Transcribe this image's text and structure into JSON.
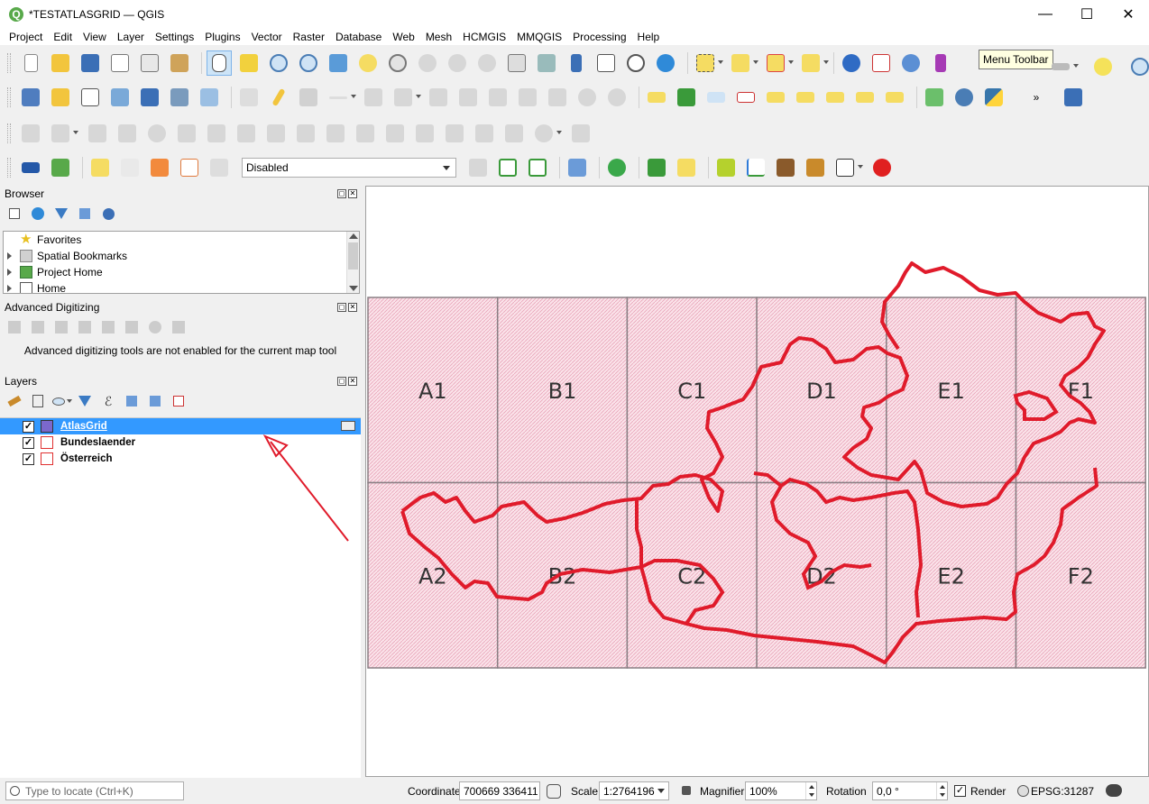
{
  "window": {
    "title": "*TESTATLASGRID — QGIS",
    "minimize": "—",
    "maximize": "☐",
    "close": "✕"
  },
  "menu": [
    "Project",
    "Edit",
    "View",
    "Layer",
    "Settings",
    "Plugins",
    "Vector",
    "Raster",
    "Database",
    "Web",
    "Mesh",
    "HCMGIS",
    "MMQGIS",
    "Processing",
    "Help"
  ],
  "tooltip": "Menu Toolbar",
  "toolbar4": {
    "select_value": "Disabled"
  },
  "browser": {
    "title": "Browser",
    "items": [
      "Favorites",
      "Spatial Bookmarks",
      "Project Home",
      "Home"
    ]
  },
  "adv_digitizing": {
    "title": "Advanced Digitizing",
    "message": "Advanced digitizing tools are not enabled for the current map tool"
  },
  "layers": {
    "title": "Layers",
    "items": [
      {
        "name": "AtlasGrid",
        "checked": true,
        "selected": true,
        "color": "#7b68cc"
      },
      {
        "name": "Bundeslaender",
        "checked": true,
        "selected": false,
        "color": "#e03030"
      },
      {
        "name": "Österreich",
        "checked": true,
        "selected": false,
        "color": "#e03030"
      }
    ]
  },
  "map": {
    "grid_labels": [
      "A1",
      "B1",
      "C1",
      "D1",
      "E1",
      "F1",
      "A2",
      "B2",
      "C2",
      "D2",
      "E2",
      "F2"
    ],
    "colors": {
      "grid_fill": "#f5c4d2",
      "grid_stroke": "#8a7f84",
      "boundary": "#e01b2b"
    }
  },
  "status": {
    "locator_placeholder": "Type to locate (Ctrl+K)",
    "coordinate_label": "Coordinate",
    "coordinate_value": "700669  336411",
    "scale_label": "Scale",
    "scale_value": "1:2764196",
    "magnifier_label": "Magnifier",
    "magnifier_value": "100%",
    "rotation_label": "Rotation",
    "rotation_value": "0,0 °",
    "render_label": "Render",
    "crs": "EPSG:31287"
  }
}
